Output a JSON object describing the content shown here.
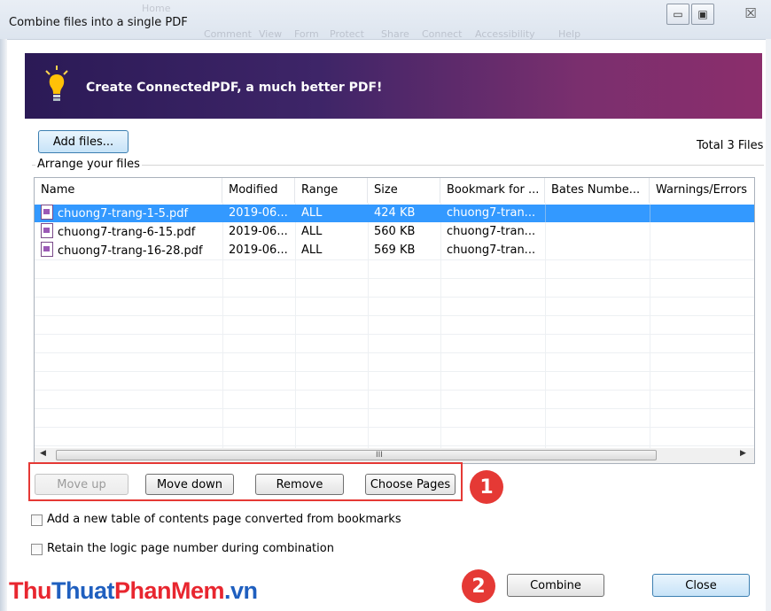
{
  "window": {
    "title": "Combine files into a single PDF",
    "ghost_menu": [
      "Home",
      "Comment",
      "View",
      "Form",
      "Protect",
      "Share",
      "Connect",
      "Accessibility",
      "Help"
    ],
    "minimize_glyph": "▭",
    "maximize_glyph": "▣",
    "close_glyph": "☒"
  },
  "banner": {
    "text": "Create ConnectedPDF, a much better PDF!",
    "icon": "lightbulb-icon"
  },
  "toolbar": {
    "add_files_label": "Add files...",
    "total_text": "Total 3 Files"
  },
  "arrange": {
    "group_label": "Arrange your files"
  },
  "table": {
    "columns": [
      "Name",
      "Modified",
      "Range",
      "Size",
      "Bookmark for ...",
      "Bates Numbe...",
      "Warnings/Errors"
    ],
    "rows": [
      {
        "name": "chuong7-trang-1-5.pdf",
        "modified": "2019-06...",
        "range": "ALL",
        "size": "424 KB",
        "bookmark": "chuong7-tran...",
        "bates": "",
        "warnings": "",
        "selected": true
      },
      {
        "name": "chuong7-trang-6-15.pdf",
        "modified": "2019-06...",
        "range": "ALL",
        "size": "560 KB",
        "bookmark": "chuong7-tran...",
        "bates": "",
        "warnings": "",
        "selected": false
      },
      {
        "name": "chuong7-trang-16-28.pdf",
        "modified": "2019-06...",
        "range": "ALL",
        "size": "569 KB",
        "bookmark": "chuong7-tran...",
        "bates": "",
        "warnings": "",
        "selected": false
      }
    ],
    "scroll": {
      "left_glyph": "◀",
      "right_glyph": "▶",
      "grip": "III"
    }
  },
  "actions": {
    "move_up": "Move up",
    "move_down": "Move down",
    "remove": "Remove",
    "choose_pages": "Choose Pages"
  },
  "options": {
    "toc_label": "Add a new table of contents page converted from bookmarks",
    "toc_checked": false,
    "logic_label": "Retain the logic page number during combination",
    "logic_checked": false
  },
  "footer": {
    "combine": "Combine",
    "close": "Close"
  },
  "annotations": {
    "badge_1": "1",
    "badge_2": "2"
  },
  "watermark": {
    "part1": "Thu",
    "part2": "Thuat",
    "part3": "PhanMem",
    "part4": ".vn"
  },
  "colors": {
    "selection": "#3399ff",
    "highlight": "#e53935",
    "banner_start": "#2b1a56",
    "banner_end": "#8b2e6c"
  }
}
